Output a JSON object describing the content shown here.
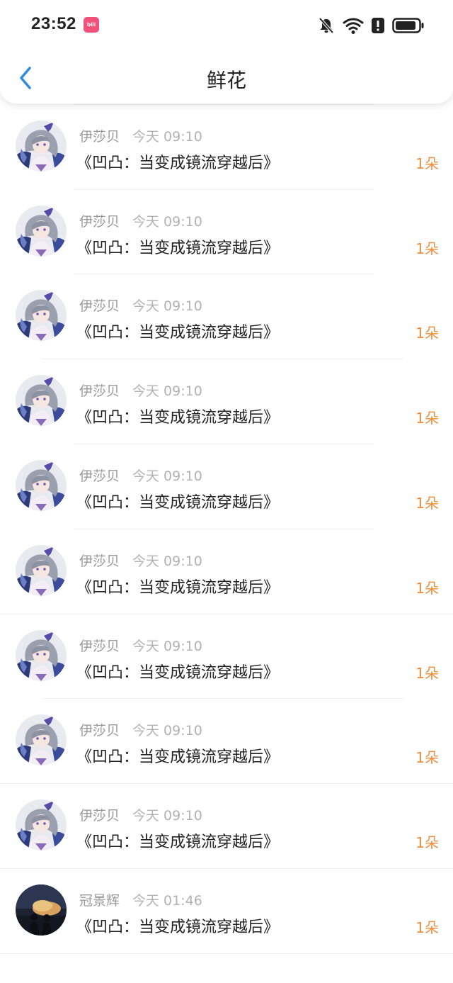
{
  "status_bar": {
    "time": "23:52",
    "app_badge": "bilibili",
    "icons": [
      "bell-off-icon",
      "wifi-icon",
      "alert-icon",
      "battery-icon"
    ]
  },
  "nav": {
    "title": "鲜花",
    "back_icon": "chevron-left-icon"
  },
  "colors": {
    "accent_blue": "#2f8be0",
    "count_orange": "#f08c3c",
    "badge_pink": "#f2527a"
  },
  "items": [
    {
      "name": "",
      "time": "",
      "title": "《凹凸：当变成镜流穿越后》",
      "count": "1朵",
      "avatar": "pink-avatar"
    },
    {
      "name": "伊莎贝",
      "time": "今天 09:10",
      "title": "《凹凸：当变成镜流穿越后》",
      "count": "1朵",
      "avatar": "anime-avatar"
    },
    {
      "name": "伊莎贝",
      "time": "今天 09:10",
      "title": "《凹凸：当变成镜流穿越后》",
      "count": "1朵",
      "avatar": "anime-avatar"
    },
    {
      "name": "伊莎贝",
      "time": "今天 09:10",
      "title": "《凹凸：当变成镜流穿越后》",
      "count": "1朵",
      "avatar": "anime-avatar"
    },
    {
      "name": "伊莎贝",
      "time": "今天 09:10",
      "title": "《凹凸：当变成镜流穿越后》",
      "count": "1朵",
      "avatar": "anime-avatar"
    },
    {
      "name": "伊莎贝",
      "time": "今天 09:10",
      "title": "《凹凸：当变成镜流穿越后》",
      "count": "1朵",
      "avatar": "anime-avatar"
    },
    {
      "name": "伊莎贝",
      "time": "今天 09:10",
      "title": "《凹凸：当变成镜流穿越后》",
      "count": "1朵",
      "avatar": "anime-avatar"
    },
    {
      "name": "伊莎贝",
      "time": "今天 09:10",
      "title": "《凹凸：当变成镜流穿越后》",
      "count": "1朵",
      "avatar": "anime-avatar"
    },
    {
      "name": "伊莎贝",
      "time": "今天 09:10",
      "title": "《凹凸：当变成镜流穿越后》",
      "count": "1朵",
      "avatar": "anime-avatar"
    },
    {
      "name": "伊莎贝",
      "time": "今天 09:10",
      "title": "《凹凸：当变成镜流穿越后》",
      "count": "1朵",
      "avatar": "anime-avatar"
    },
    {
      "name": "冠景辉",
      "time": "今天 01:46",
      "title": "《凹凸：当变成镜流穿越后》",
      "count": "1朵",
      "avatar": "sunset-avatar"
    }
  ]
}
